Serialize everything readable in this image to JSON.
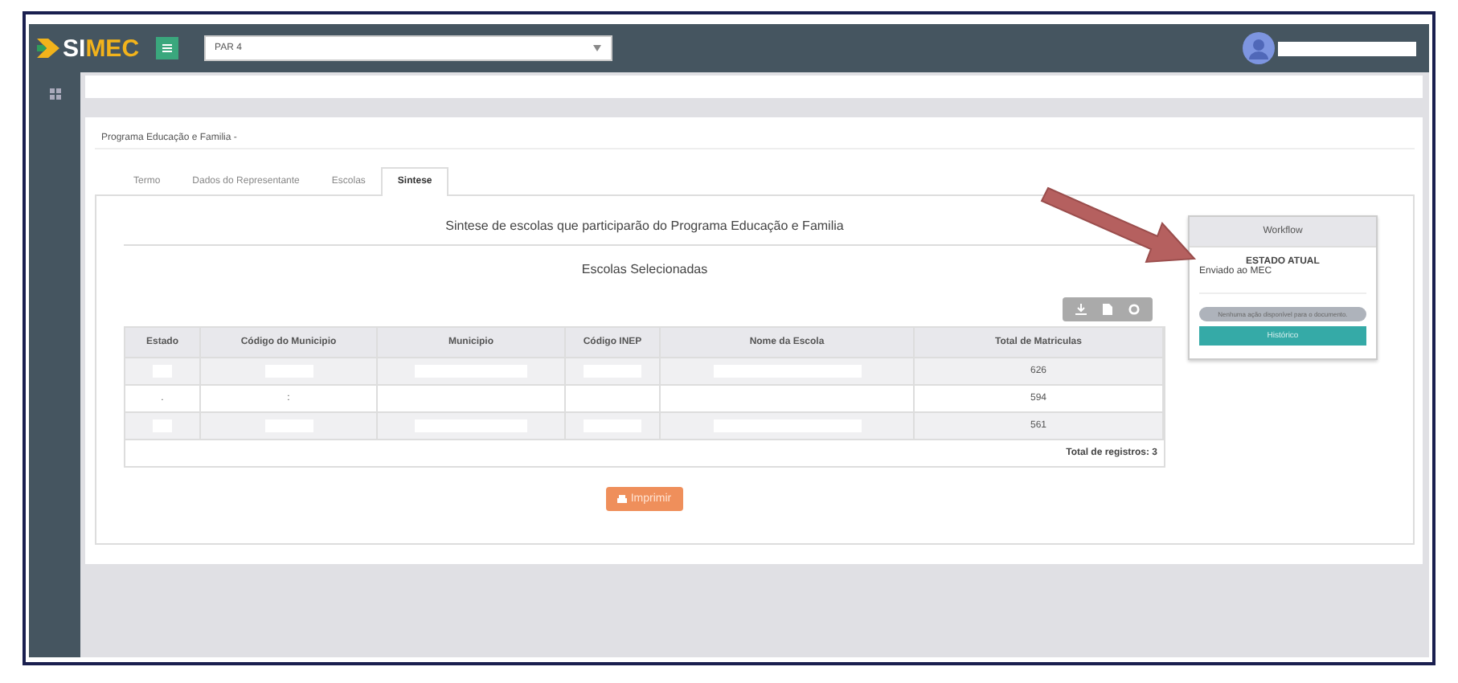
{
  "header": {
    "logo_prefix": "SI",
    "logo_suffix": "MEC",
    "select": "PAR 4"
  },
  "breadcrumb": "Programa Educação e Familia -",
  "tabs": [
    {
      "label": "Termo",
      "selected": false
    },
    {
      "label": "Dados do Representante",
      "selected": false
    },
    {
      "label": "Escolas",
      "selected": false
    },
    {
      "label": "Sintese",
      "selected": true
    }
  ],
  "panel_title": "Sintese de escolas que participarão do Programa Educação e Familia",
  "table_title": "Escolas Selecionadas",
  "table": {
    "columns": [
      "Estado",
      "Código do Municipio",
      "Municipio",
      "Código INEP",
      "Nome da Escola",
      "Total de Matriculas"
    ],
    "rows": [
      {
        "cells": [
          {
            "kind": "redacted"
          },
          {
            "kind": "redacted"
          },
          {
            "kind": "redacted"
          },
          {
            "kind": "redacted"
          },
          {
            "kind": "redacted"
          },
          {
            "kind": "text",
            "text": "626"
          }
        ]
      },
      {
        "cells": [
          {
            "kind": "text",
            "text": "."
          },
          {
            "kind": "text",
            "text": ":"
          },
          {
            "kind": "blank"
          },
          {
            "kind": "blank"
          },
          {
            "kind": "blank"
          },
          {
            "kind": "text",
            "text": "594"
          }
        ]
      },
      {
        "cells": [
          {
            "kind": "redacted"
          },
          {
            "kind": "redacted"
          },
          {
            "kind": "redacted"
          },
          {
            "kind": "redacted"
          },
          {
            "kind": "redacted"
          },
          {
            "kind": "text",
            "text": "561"
          }
        ]
      }
    ],
    "footer": "Total de registros: 3"
  },
  "print_button": "Imprimir",
  "workflow": {
    "title": "Workflow",
    "state_label": "ESTADO ATUAL",
    "state": "Enviado ao MEC",
    "note": "Nenhuma ação disponível para o documento.",
    "history_button": "Histórico"
  }
}
